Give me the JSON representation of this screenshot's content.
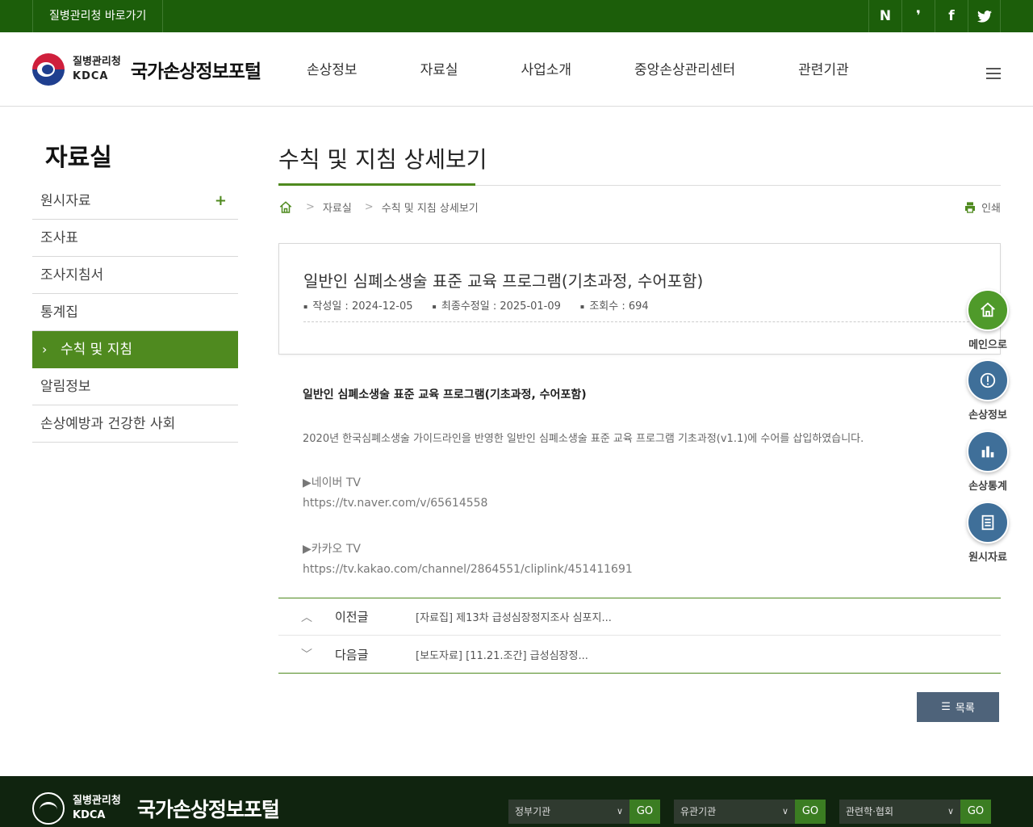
{
  "topbar": {
    "shortcut": "질병관리청 바로가기",
    "sns": [
      "N",
      "❜",
      "f",
      "t"
    ]
  },
  "header": {
    "org_name": "질병관리청",
    "org_abbr": "KDCA",
    "portal_name": "국가손상정보포털",
    "gnb": [
      "손상정보",
      "자료실",
      "사업소개",
      "중앙손상관리센터",
      "관련기관"
    ]
  },
  "sidebar": {
    "title": "자료실",
    "items": [
      {
        "label": "원시자료",
        "has_plus": true
      },
      {
        "label": "조사표"
      },
      {
        "label": "조사지침서"
      },
      {
        "label": "통계집"
      },
      {
        "label": "수칙 및 지침",
        "active": true
      },
      {
        "label": "알림정보"
      },
      {
        "label": "손상예방과 건강한 사회"
      }
    ],
    "plus": "+"
  },
  "content": {
    "page_title": "수칙 및 지침 상세보기",
    "breadcrumb": [
      "자료실",
      "수칙 및 지침 상세보기"
    ],
    "print_label": "인쇄",
    "post": {
      "title": "일반인 심폐소생술 표준 교육 프로그램(기초과정, 수어포함)",
      "meta": [
        "작성일 : 2024-12-05",
        "최종수정일 : 2025-01-09",
        "조회수 : 694"
      ],
      "body_title": "일반인 심폐소생술 표준 교육 프로그램(기초과정, 수어포함)",
      "body_text": "2020년 한국심폐소생술 가이드라인을 반영한 일반인 심폐소생술 표준 교육 프로그램 기초과정(v1.1)에 수어를 삽입하였습니다.",
      "links": [
        {
          "label": "▶네이버 TV",
          "url": "https://tv.naver.com/v/65614558"
        },
        {
          "label": "▶카카오 TV",
          "url": "https://tv.kakao.com/channel/2864551/cliplink/451411691"
        }
      ]
    },
    "nav": {
      "prev_label": "이전글",
      "prev_title": "[자료집] 제13차 급성심장정지조사 심포지...",
      "next_label": "다음글",
      "next_title": "[보도자료] [11.21.조간] 급성심장정..."
    },
    "list_button": "목록"
  },
  "quick_menu": [
    {
      "label": "메인으로",
      "icon": "home-icon",
      "color": "#4f9a2a"
    },
    {
      "label": "손상정보",
      "icon": "alert-icon",
      "color": "#3f6f99"
    },
    {
      "label": "손상통계",
      "icon": "bar-chart-icon",
      "color": "#3f6f99"
    },
    {
      "label": "원시자료",
      "icon": "document-icon",
      "color": "#3f6f99"
    }
  ],
  "footer": {
    "org_name": "질병관리청",
    "org_abbr": "KDCA",
    "portal_name": "국가손상정보포털",
    "selects": [
      {
        "label": "정부기관",
        "go": "GO"
      },
      {
        "label": "유관기관",
        "go": "GO"
      },
      {
        "label": "관련학·협회",
        "go": "GO"
      }
    ]
  }
}
